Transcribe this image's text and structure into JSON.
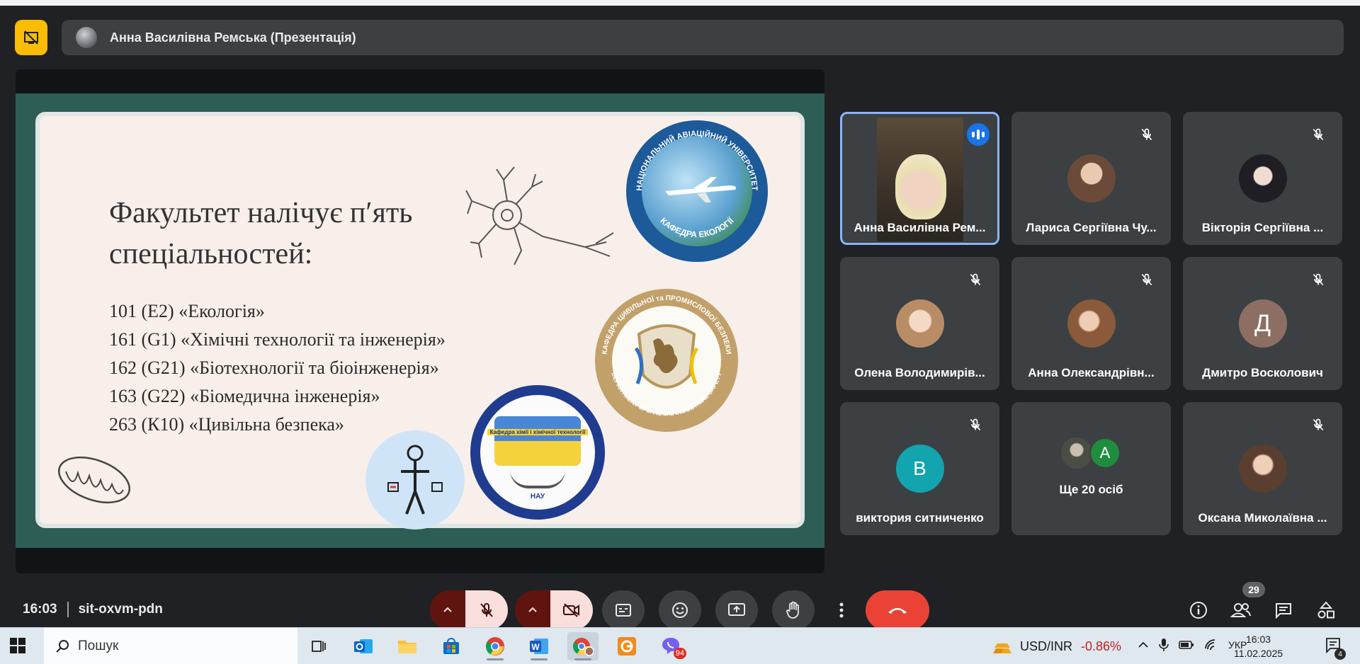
{
  "presenter_banner": {
    "title": "Анна Василівна Ремська (Презентація)",
    "stop_icon": "stop-presenting-icon"
  },
  "slide": {
    "title": "Факультет налічує п′ять\nспеціальностей:",
    "items": [
      "101 (E2) «Екологія»",
      "161 (G1) «Хімічні технології та інженерія»",
      "162 (G21) «Біотехнології та біоінженерія»",
      "163 (G22) «Біомедична інженерія»",
      "263 (К10) «Цивільна безпека»"
    ],
    "logos": {
      "ecology": {
        "top_text": "НАЦІОНАЛЬНИЙ АВІАЦІЙНИЙ УНІВЕРСИТЕТ",
        "bottom_text": "КАФЕДРА ЕКОЛОГІЇ"
      },
      "civil_safety": {
        "top_text": "КАФЕДРА ЦИВІЛЬНОЇ та ПРОМИСЛОВОЇ БЕЗПЕКИ",
        "bottom_text": "DEPARTMENT of CIVIL and INDUSTRIAL SAFETY"
      },
      "chemistry": {
        "banner_text": "Кафедра хімії і хімічної технології",
        "bottom_text": "НАУ"
      }
    }
  },
  "participants": [
    {
      "name": "Анна Василівна Рем...",
      "state": "speaking",
      "media": "video",
      "active": true
    },
    {
      "name": "Лариса Сергіївна Чу...",
      "state": "muted",
      "media": "photo",
      "avatar_color": "#6b4a3a"
    },
    {
      "name": "Вікторія Сергіївна ...",
      "state": "muted",
      "media": "photo",
      "avatar_color": "#2a2a30"
    },
    {
      "name": "Олена Володимирів...",
      "state": "muted",
      "media": "photo",
      "avatar_color": "#c9a27a"
    },
    {
      "name": "Анна Олександрівн...",
      "state": "muted",
      "media": "photo",
      "avatar_color": "#8a5a3a"
    },
    {
      "name": "Дмитро Восколович",
      "state": "muted",
      "media": "initial",
      "initial": "Д",
      "avatar_color": "#8d6e63"
    },
    {
      "name": "виктория ситниченко",
      "state": "muted",
      "media": "initial",
      "initial": "B",
      "avatar_color": "#12a4af"
    },
    {
      "name": "Ще 20 осіб",
      "state": "none",
      "media": "group",
      "initial": "A",
      "avatar_color": "#1e8e3e"
    },
    {
      "name": "Оксана Миколаївна ...",
      "state": "muted",
      "media": "photo",
      "avatar_color": "#5a3e30"
    }
  ],
  "meeting": {
    "time": "16:03",
    "code": "sit-oxvm-pdn",
    "people_count": "29",
    "controls": [
      "mic-options",
      "mic-off",
      "camera-options",
      "camera-off",
      "captions",
      "reactions",
      "present",
      "raise-hand",
      "more-options",
      "leave-call"
    ],
    "right_controls": [
      "meeting-info",
      "people",
      "chat",
      "activities"
    ]
  },
  "taskbar": {
    "search_label": "Пошук",
    "apps": [
      "task-view",
      "outlook",
      "file-explorer",
      "microsoft-store",
      "chrome",
      "word",
      "chrome-profile",
      "presentation-app",
      "viber"
    ],
    "viber_badge": "94",
    "ticker_pair": "USD/INR",
    "ticker_change": "-0.86%",
    "language": "УКР",
    "clock_time": "16:03",
    "clock_date": "11.02.2025",
    "notifications": "4"
  },
  "colors": {
    "accent_blue": "#1a73e8",
    "end_call_red": "#ea4335",
    "stop_yellow": "#fbbc04",
    "slide_green": "#2d5e55",
    "negative_change": "#c5221f"
  }
}
